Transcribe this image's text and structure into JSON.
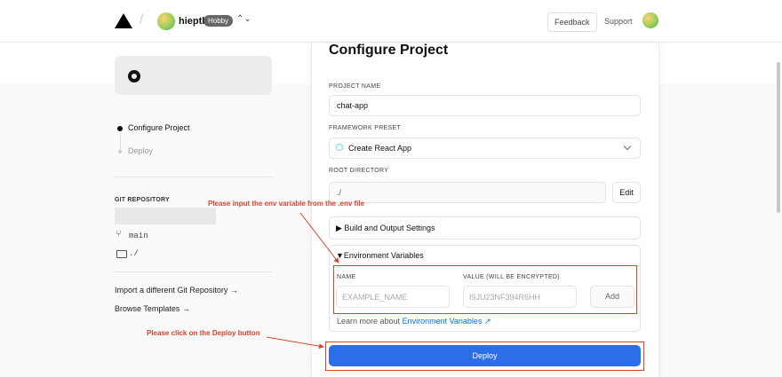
{
  "nav": {
    "username": "hieptl",
    "plan_badge": "Hobby",
    "feedback_label": "Feedback",
    "support_label": "Support"
  },
  "sidebar": {
    "steps": [
      {
        "label": "Configure Project",
        "active": true
      },
      {
        "label": "Deploy",
        "active": false
      }
    ],
    "git_repository_label": "GIT REPOSITORY",
    "branch": "main",
    "root_dir": "./",
    "import_link": "Import a different Git Repository →",
    "browse_link": "Browse Templates →"
  },
  "panel": {
    "title": "Configure Project",
    "project_name_label": "PROJECT NAME",
    "project_name_value": "chat-app",
    "framework_label": "FRAMEWORK PRESET",
    "framework_value": "Create React App",
    "root_dir_label": "ROOT DIRECTORY",
    "root_dir_value": "./",
    "edit_label": "Edit",
    "build_settings_label": "▶ Build and Output Settings",
    "env_section_label": "▼Environment Variables",
    "env_name_label": "NAME",
    "env_value_label": "VALUE (WILL BE ENCRYPTED)",
    "env_name_placeholder": "EXAMPLE_NAME",
    "env_value_placeholder": "I9JU23NF394R6HH",
    "add_label": "Add",
    "learn_more_text": "Learn more about",
    "learn_more_link": "Environment Variables",
    "deploy_label": "Deploy"
  },
  "annotations": {
    "env_note": "Please input the env variable from the .env file",
    "deploy_note": "Please click on the Deploy button"
  },
  "colors": {
    "accent": "#2b6ee8",
    "annotation": "#e0412e",
    "link": "#0070f3"
  }
}
